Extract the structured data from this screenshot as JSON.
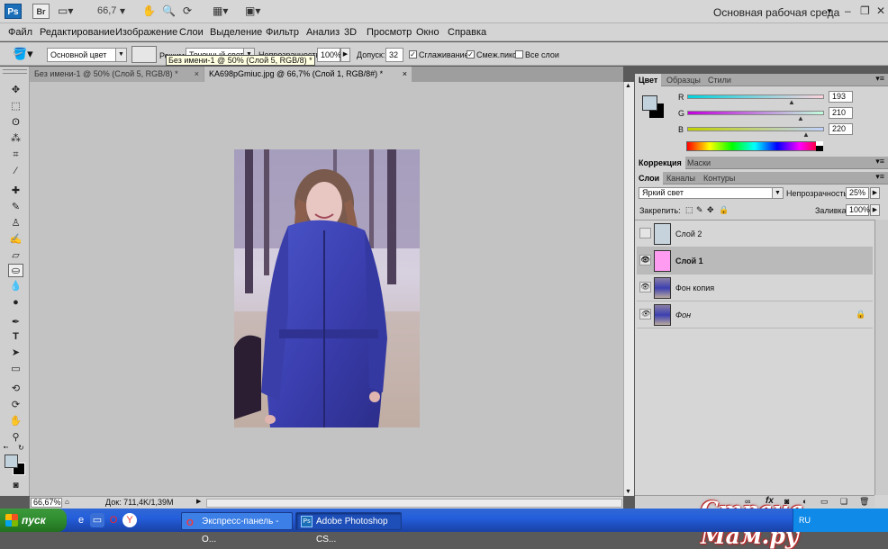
{
  "titlebar": {
    "app_icon": "Ps",
    "bridge_icon": "Br",
    "zoom": "66,7",
    "workspace": "Основная рабочая среда",
    "workspace_arrow": "▼",
    "minimize": "–",
    "restore": "❐",
    "close": "✕"
  },
  "menu": [
    "Файл",
    "Редактирование",
    "Изображение",
    "Слои",
    "Выделение",
    "Фильтр",
    "Анализ",
    "3D",
    "Просмотр",
    "Окно",
    "Справка"
  ],
  "options": {
    "fill_source": "Основной цвет",
    "mode_label": "Режим:",
    "mode_value": "Точечный свет",
    "opacity_label": "Непрозрачность:",
    "opacity_value": "100%",
    "tolerance_label": "Допуск:",
    "tolerance_value": "32",
    "antialias_label": "Сглаживание",
    "contiguous_label": "Смеж.пикс",
    "all_layers_label": "Все слои",
    "tooltip": "Без имени-1 @ 50% (Слой 5, RGB/8) *"
  },
  "tabs": [
    {
      "label": "Без имени-1 @ 50% (Слой 5, RGB/8) *",
      "close": "×"
    },
    {
      "label": "KA698pGmiuc.jpg @ 66,7% (Слой 1, RGB/8#) *",
      "close": "×"
    }
  ],
  "status": {
    "zoom": "66,67%",
    "doc": "Док: 711,4K/1,39M"
  },
  "color_panel": {
    "tabs": [
      "Цвет",
      "Образцы",
      "Стили"
    ],
    "r_label": "R",
    "r_value": "193",
    "g_label": "G",
    "g_value": "210",
    "b_label": "B",
    "b_value": "220",
    "foreground": "#c1d2dc"
  },
  "adjust_panel": {
    "tabs": [
      "Коррекция",
      "Маски"
    ]
  },
  "layers_panel": {
    "tabs": [
      "Слои",
      "Каналы",
      "Контуры"
    ],
    "blend_mode": "Яркий свет",
    "opacity_label": "Непрозрачность:",
    "opacity_value": "25%",
    "lock_label": "Закрепить:",
    "fill_label": "Заливка:",
    "fill_value": "100%",
    "layers": [
      {
        "name": "Слой 2",
        "visible": false,
        "thumb": "#c6d3dc",
        "selected": false
      },
      {
        "name": "Слой 1",
        "visible": true,
        "thumb": "#ff9cf2",
        "selected": true
      },
      {
        "name": "Фон копия",
        "visible": true,
        "thumb": "photo",
        "selected": false
      },
      {
        "name": "Фон",
        "visible": true,
        "thumb": "photo",
        "selected": false,
        "locked": true
      }
    ]
  },
  "taskbar": {
    "start": "пуск",
    "tasks": [
      "Экспресс-панель - О...",
      "Adobe Photoshop CS..."
    ],
    "lang": "RU"
  },
  "watermark": "Страна Мам.ру"
}
